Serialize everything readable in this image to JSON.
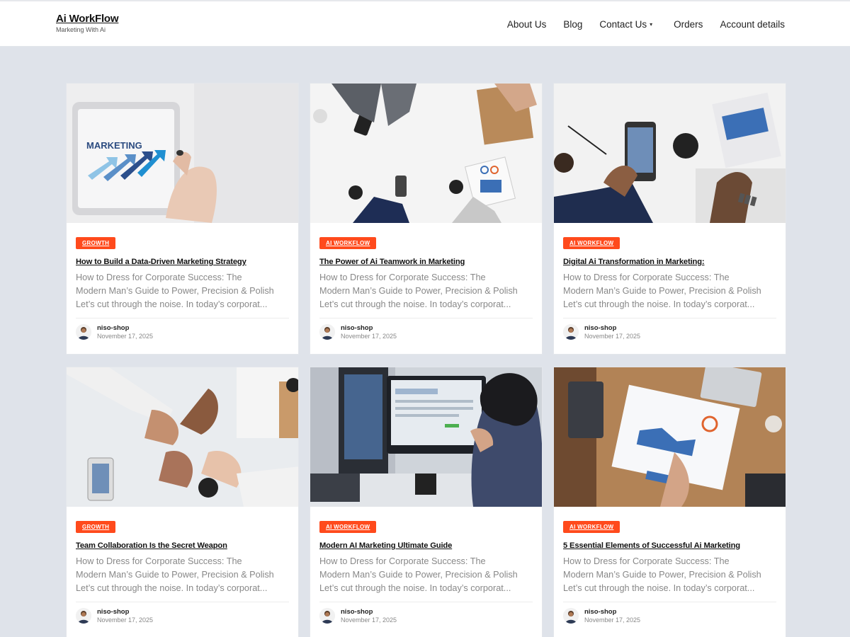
{
  "header": {
    "brand_name": "Ai WorkFlow",
    "brand_tagline": "Marketing With Ai",
    "nav": [
      {
        "label": "About Us"
      },
      {
        "label": "Blog"
      },
      {
        "label": "Contact Us"
      },
      {
        "label": "Orders"
      },
      {
        "label": "Account details"
      }
    ],
    "contact_caret": "▾"
  },
  "posts": [
    {
      "category": "GROWTH",
      "title": "How to Build a Data-Driven Marketing Strategy",
      "excerpt": [
        "How to Dress for Corporate Success: The",
        "Modern Man’s Guide to Power, Precision & Polish",
        "Let’s cut through the noise. In today’s corporat..."
      ],
      "author": "niso-shop",
      "date": "November 17, 2025",
      "image": "tablet-marketing-photo"
    },
    {
      "category": "AI WORKFLOW",
      "title": "The Power of Ai Teamwork in Marketing",
      "excerpt": [
        "How to Dress for Corporate Success: The",
        "Modern Man’s Guide to Power, Precision & Polish",
        "Let’s cut through the noise. In today’s corporat..."
      ],
      "author": "niso-shop",
      "date": "November 17, 2025",
      "image": "team-desk-overhead-photo"
    },
    {
      "category": "AI WORKFLOW",
      "title": "Digital Ai Transformation in Marketing:",
      "excerpt": [
        "How to Dress for Corporate Success: The",
        "Modern Man’s Guide to Power, Precision & Polish",
        "Let’s cut through the noise. In today’s corporat..."
      ],
      "author": "niso-shop",
      "date": "November 17, 2025",
      "image": "phone-newspaper-photo"
    },
    {
      "category": "GROWTH",
      "title": "Team Collaboration Is the Secret Weapon",
      "excerpt": [
        "How to Dress for Corporate Success: The",
        "Modern Man’s Guide to Power, Precision & Polish",
        "Let’s cut through the noise. In today’s corporat..."
      ],
      "author": "niso-shop",
      "date": "November 17, 2025",
      "image": "fist-bump-photo"
    },
    {
      "category": "AI WORKFLOW",
      "title": "Modern AI Marketing Ultimate Guide",
      "excerpt": [
        "How to Dress for Corporate Success: The",
        "Modern Man’s Guide to Power, Precision & Polish",
        "Let’s cut through the noise. In today’s corporat..."
      ],
      "author": "niso-shop",
      "date": "November 17, 2025",
      "image": "woman-computer-photo"
    },
    {
      "category": "AI WORKFLOW",
      "title": "5 Essential Elements of Successful Ai Marketing",
      "excerpt": [
        "How to Dress for Corporate Success: The",
        "Modern Man’s Guide to Power, Precision & Polish",
        "Let’s cut through the noise. In today’s corporat..."
      ],
      "author": "niso-shop",
      "date": "November 17, 2025",
      "image": "charts-table-photo"
    }
  ],
  "image_tablet_text": "MARKETING",
  "colors": {
    "accent": "#ff4a1c",
    "page_bg": "#dfe3ea",
    "excerpt": "#888888"
  }
}
